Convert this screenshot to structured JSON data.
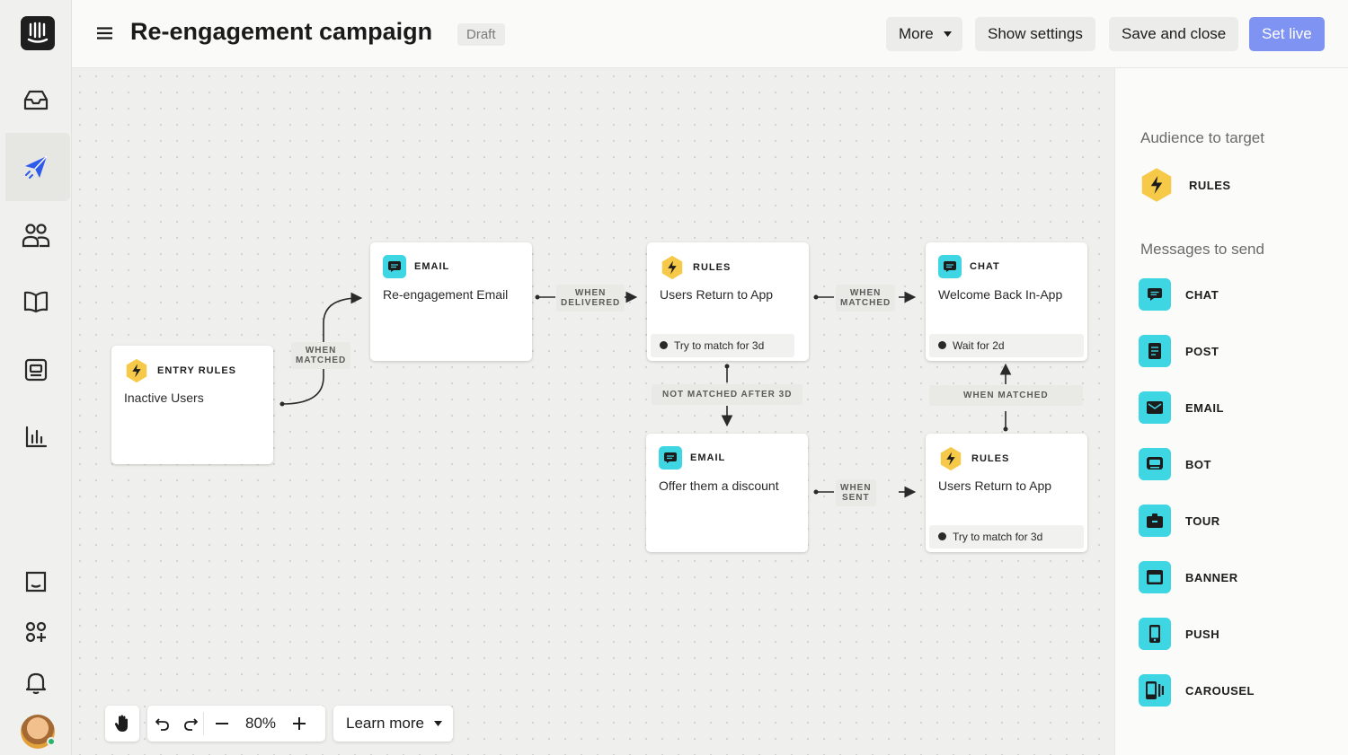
{
  "header": {
    "title": "Re-engagement campaign",
    "status": "Draft",
    "more_label": "More",
    "show_settings_label": "Show settings",
    "save_close_label": "Save and close",
    "set_live_label": "Set live"
  },
  "nodes": {
    "entry": {
      "type": "ENTRY RULES",
      "name": "Inactive Users"
    },
    "email1": {
      "type": "EMAIL",
      "name": "Re-engagement Email"
    },
    "rules1": {
      "type": "RULES",
      "name": "Users Return to App",
      "foot": "Try to match for 3d"
    },
    "chat": {
      "type": "CHAT",
      "name": "Welcome Back In-App",
      "foot": "Wait for 2d"
    },
    "email2": {
      "type": "EMAIL",
      "name": "Offer them a discount"
    },
    "rules2": {
      "type": "RULES",
      "name": "Users Return to App",
      "foot": "Try to match for 3d"
    }
  },
  "edges": {
    "when_matched_1_a": "WHEN",
    "when_matched_1_b": "MATCHED",
    "when_delivered_a": "WHEN",
    "when_delivered_b": "DELIVERED",
    "when_matched_2_a": "WHEN",
    "when_matched_2_b": "MATCHED",
    "not_matched": "NOT MATCHED AFTER 3D",
    "when_matched_3": "WHEN MATCHED",
    "when_sent_a": "WHEN",
    "when_sent_b": "SENT"
  },
  "toolbar": {
    "zoom": "80%",
    "learn_more": "Learn more"
  },
  "panel": {
    "audience_title": "Audience to target",
    "audience_items": [
      {
        "label": "RULES",
        "icon": "bolt-icon"
      }
    ],
    "messages_title": "Messages to send",
    "message_items": [
      {
        "label": "CHAT",
        "icon": "chat-icon"
      },
      {
        "label": "POST",
        "icon": "post-icon"
      },
      {
        "label": "EMAIL",
        "icon": "email-icon"
      },
      {
        "label": "BOT",
        "icon": "bot-icon"
      },
      {
        "label": "TOUR",
        "icon": "tour-icon"
      },
      {
        "label": "BANNER",
        "icon": "banner-icon"
      },
      {
        "label": "PUSH",
        "icon": "push-icon"
      },
      {
        "label": "CAROUSEL",
        "icon": "carousel-icon"
      }
    ]
  },
  "colors": {
    "accent": "#7f93f2",
    "message_teal": "#3fd6e4",
    "rules_yellow": "#f7c948",
    "nav_active": "#2f5bea"
  }
}
